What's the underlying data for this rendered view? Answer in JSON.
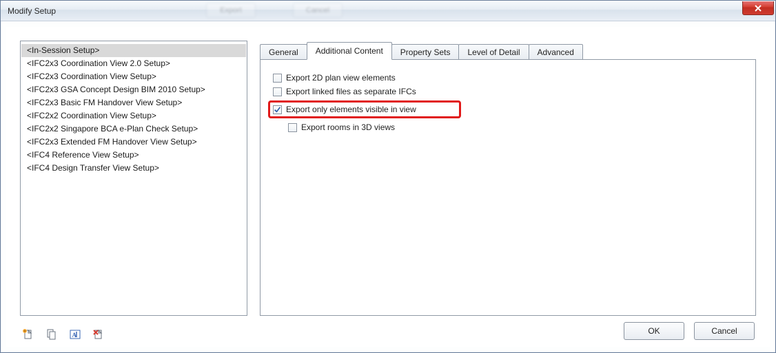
{
  "window": {
    "title": "Modify Setup",
    "ghost_button_1": "Export",
    "ghost_button_2": "Cancel"
  },
  "setups": {
    "selected_index": 0,
    "items": [
      "<In-Session Setup>",
      "<IFC2x3 Coordination View 2.0 Setup>",
      "<IFC2x3 Coordination View Setup>",
      "<IFC2x3 GSA Concept Design BIM 2010 Setup>",
      "<IFC2x3 Basic FM Handover View Setup>",
      "<IFC2x2 Coordination View Setup>",
      "<IFC2x2 Singapore BCA e-Plan Check Setup>",
      "<IFC2x3 Extended FM Handover View Setup>",
      "<IFC4 Reference View Setup>",
      "<IFC4 Design Transfer View Setup>"
    ]
  },
  "tabs": {
    "items": [
      "General",
      "Additional Content",
      "Property Sets",
      "Level of Detail",
      "Advanced"
    ],
    "active_index": 1
  },
  "additional_content": {
    "chk_2d": {
      "label": "Export 2D plan view elements",
      "checked": false
    },
    "chk_linked": {
      "label": "Export linked files as separate IFCs",
      "checked": false
    },
    "chk_visible": {
      "label": "Export only elements visible in view",
      "checked": true
    },
    "chk_rooms": {
      "label": "Export rooms in 3D views",
      "checked": false
    }
  },
  "footer": {
    "ok": "OK",
    "cancel": "Cancel"
  }
}
